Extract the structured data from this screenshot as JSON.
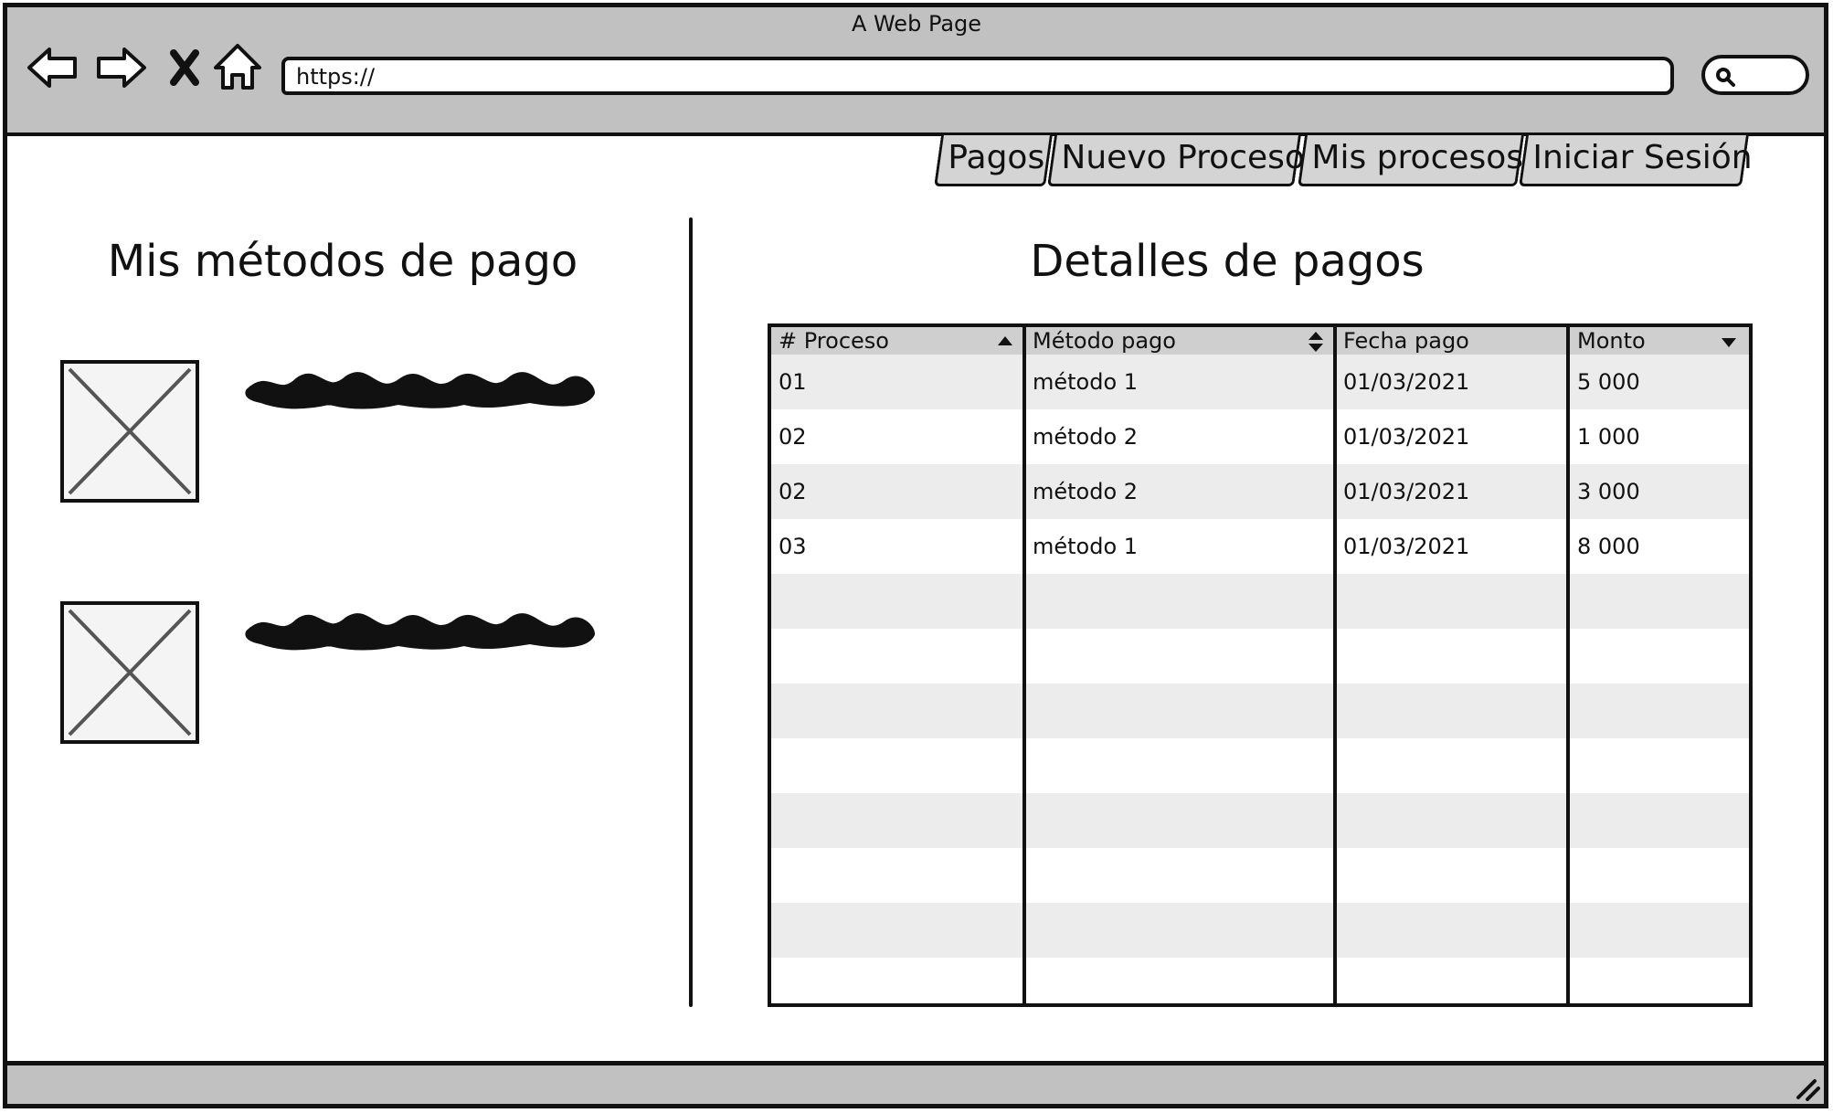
{
  "window": {
    "title": "A Web Page",
    "url": "https://"
  },
  "nav": {
    "icons": [
      "back-icon",
      "forward-icon",
      "close-icon",
      "home-icon",
      "search-icon"
    ]
  },
  "tabs": [
    "Pagos",
    "Nuevo Proceso",
    "Mis procesos",
    "Iniciar Sesión"
  ],
  "payment_methods": {
    "title": "Mis métodos de pago",
    "items": [
      {
        "icon": "image-placeholder-icon"
      },
      {
        "icon": "image-placeholder-icon"
      }
    ]
  },
  "payments": {
    "title": "Detalles de pagos",
    "columns": [
      {
        "label": "# Proceso",
        "sort": "ascending"
      },
      {
        "label": "Método pago",
        "sort": "sortable"
      },
      {
        "label": "Fecha pago",
        "sort": "none"
      },
      {
        "label": "Monto",
        "sort": "descending"
      }
    ],
    "rows": [
      {
        "proceso": "01",
        "metodo": "método 1",
        "fecha": "01/03/2021",
        "monto": "5 000"
      },
      {
        "proceso": "02",
        "metodo": "método 2",
        "fecha": "01/03/2021",
        "monto": "1 000"
      },
      {
        "proceso": "02",
        "metodo": "método 2",
        "fecha": "01/03/2021",
        "monto": "3 000"
      },
      {
        "proceso": "03",
        "metodo": "método 1",
        "fecha": "01/03/2021",
        "monto": "8 000"
      }
    ],
    "empty_rows": 8
  }
}
